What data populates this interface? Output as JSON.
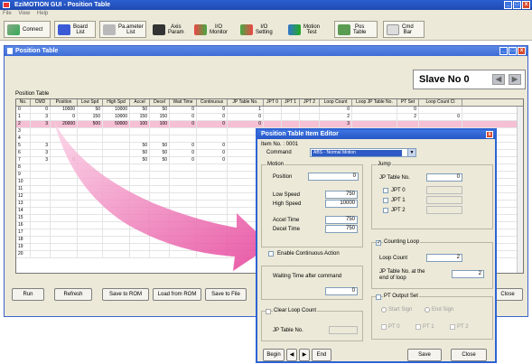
{
  "app": {
    "title": "EziMOTION GUI - Position Table",
    "menu": [
      "File",
      "View",
      "Help"
    ]
  },
  "toolbar": {
    "connect": "Connect",
    "board_list": "Board\nList",
    "parameter_list": "Pa.ameter\nList",
    "axis_param": "Axis\nParam",
    "io_monitor": "I/O\nMonitor",
    "io_setting": "I/O\nSetting",
    "motion_test": "Motion\nTest",
    "pos_table": "Pos\nTable",
    "cmd_bar": "Cmd\nBar"
  },
  "window": {
    "title": "Position Table",
    "slave_label": "Slave No",
    "slave_no": "0",
    "table_label": "Position Table",
    "columns": [
      "No.",
      "CMD",
      "Position",
      "Low Spd",
      "High Spd",
      "Accel",
      "Decel",
      "Wait Time",
      "Continuous",
      "JP Table No.",
      "JPT 0",
      "JPT 1",
      "JPT 2",
      "Loop Count",
      "Loop JP Table No.",
      "PT Set",
      "Loop Count Cl"
    ],
    "rows": [
      [
        "0",
        "0",
        "10000",
        "50",
        "10000",
        "50",
        "50",
        "0",
        "0",
        "1",
        "",
        "",
        "",
        "0",
        "",
        "0",
        ""
      ],
      [
        "1",
        "3",
        "0",
        "150",
        "10000",
        "150",
        "150",
        "0",
        "0",
        "0",
        "",
        "",
        "",
        "2",
        "",
        "2",
        "0"
      ],
      [
        "2",
        "3",
        "20000",
        "500",
        "50000",
        "100",
        "100",
        "0",
        "0",
        "0",
        "",
        "",
        "",
        "3",
        "",
        "",
        ""
      ],
      [
        "3",
        "",
        "",
        "",
        "",
        "",
        "",
        "",
        "",
        "",
        "",
        "",
        "",
        "",
        "",
        "",
        ""
      ],
      [
        "4",
        "",
        "",
        "",
        "",
        "",
        "",
        "",
        "",
        "",
        "",
        "",
        "",
        "",
        "",
        "",
        ""
      ],
      [
        "5",
        "3",
        "",
        "",
        "",
        "50",
        "50",
        "0",
        "0",
        "",
        "",
        "",
        "",
        "",
        "",
        "",
        ""
      ],
      [
        "6",
        "3",
        "",
        "",
        "",
        "50",
        "50",
        "0",
        "0",
        "",
        "",
        "",
        "",
        "",
        "",
        "",
        ""
      ],
      [
        "7",
        "3",
        "0",
        "",
        "",
        "50",
        "50",
        "0",
        "0",
        "",
        "",
        "",
        "",
        "",
        "",
        "",
        ""
      ],
      [
        "8",
        "",
        "",
        "",
        "",
        "",
        "",
        "",
        "",
        "",
        "",
        "",
        "",
        "",
        "",
        "",
        ""
      ],
      [
        "9",
        "",
        "",
        "",
        "",
        "",
        "",
        "",
        "",
        "",
        "",
        "",
        "",
        "",
        "",
        "",
        ""
      ],
      [
        "10",
        "",
        "",
        "",
        "",
        "",
        "",
        "",
        "",
        "",
        "",
        "",
        "",
        "",
        "",
        "",
        ""
      ],
      [
        "11",
        "",
        "",
        "",
        "",
        "",
        "",
        "",
        "",
        "",
        "",
        "",
        "",
        "",
        "",
        "",
        ""
      ],
      [
        "12",
        "",
        "",
        "",
        "",
        "",
        "",
        "",
        "",
        "",
        "",
        "",
        "",
        "",
        "",
        "",
        ""
      ],
      [
        "13",
        "",
        "",
        "",
        "",
        "",
        "",
        "",
        "",
        "",
        "",
        "",
        "",
        "",
        "",
        "",
        ""
      ],
      [
        "14",
        "",
        "",
        "",
        "",
        "",
        "",
        "",
        "",
        "",
        "",
        "",
        "",
        "",
        "",
        "",
        ""
      ],
      [
        "15",
        "",
        "",
        "",
        "",
        "",
        "",
        "",
        "",
        "",
        "",
        "",
        "",
        "",
        "",
        "",
        ""
      ],
      [
        "16",
        "",
        "",
        "",
        "",
        "",
        "",
        "",
        "",
        "",
        "",
        "",
        "",
        "",
        "",
        "",
        ""
      ],
      [
        "17",
        "",
        "",
        "",
        "",
        "",
        "",
        "",
        "",
        "",
        "",
        "",
        "",
        "",
        "",
        "",
        ""
      ],
      [
        "18",
        "",
        "",
        "",
        "",
        "",
        "",
        "",
        "",
        "",
        "",
        "",
        "",
        "",
        "",
        "",
        ""
      ],
      [
        "19",
        "",
        "",
        "",
        "",
        "",
        "",
        "",
        "",
        "",
        "",
        "",
        "",
        "",
        "",
        "",
        ""
      ],
      [
        "20",
        "",
        "",
        "",
        "",
        "",
        "",
        "",
        "",
        "",
        "",
        "",
        "",
        "",
        "",
        "",
        ""
      ]
    ],
    "buttons": {
      "run": "Run",
      "refresh": "Refresh",
      "save_rom": "Save to ROM",
      "load_rom": "Load from ROM",
      "save_file": "Save to File",
      "close": "Close"
    }
  },
  "dialog": {
    "title": "Position Table Item Editor",
    "item_no": "Item No. : 0001",
    "command_label": "Command",
    "command_value": "ABS - Normal Motion",
    "motion_group": "Motion",
    "position_label": "Position",
    "position_value": "0",
    "low_speed_label": "Low Speed",
    "low_speed_value": "750",
    "high_speed_label": "High Speed",
    "high_speed_value": "10000",
    "accel_label": "Accel Time",
    "accel_value": "750",
    "decel_label": "Decel Time",
    "decel_value": "750",
    "continuous_label": "Enable Continuous Action",
    "jump_group": "Jump",
    "jp_table_label": "JP Table No.",
    "jp_table_value": "0",
    "jpt0": "JPT 0",
    "jpt1": "JPT 1",
    "jpt2": "JPT 2",
    "counting_loop_label": "Counting Loop",
    "loop_count_label": "Loop Count",
    "loop_count_value": "2",
    "jp_end_loop_label": "JP Table No. at the end of loop",
    "jp_end_loop_value": "2",
    "waiting_label": "Waiting Time after command",
    "waiting_value": "0",
    "clear_loop_label": "Clear Loop Count",
    "clear_jp_label": "JP Table No.",
    "pt_output_label": "PT Output Set",
    "start_sign": "Start Sign",
    "end_sign": "End Sign",
    "pt0": "PT 0",
    "pt1": "PT 1",
    "pt2": "PT 2",
    "begin": "Begin",
    "prev": "◀",
    "next": "▶",
    "end": "End",
    "save": "Save",
    "close": "Close"
  },
  "colors": {
    "title_blue": "#2b5fd0",
    "selected_row": "#f5bfd4",
    "highlight_pink": "#ec4aa0"
  }
}
